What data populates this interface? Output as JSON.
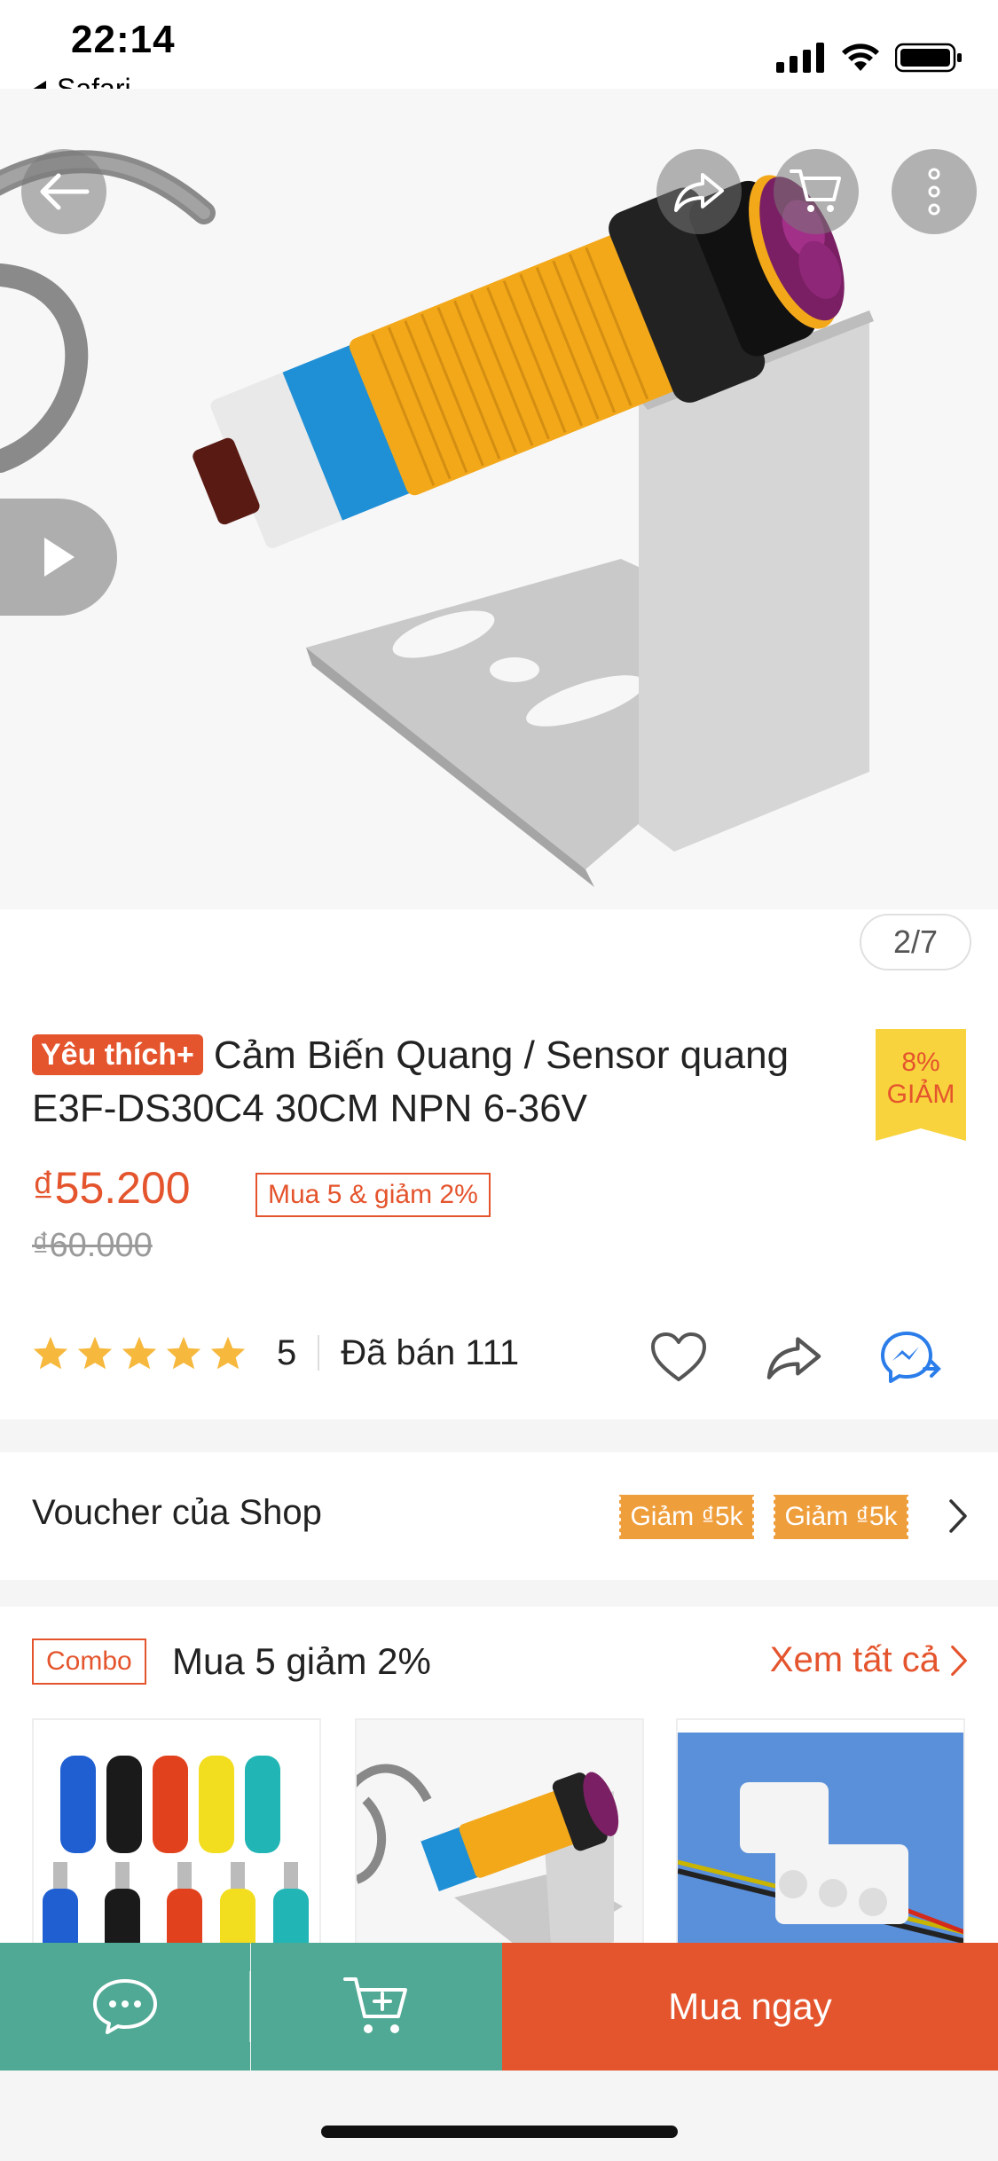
{
  "status_bar": {
    "time": "22:14",
    "back_app": "Safari"
  },
  "gallery": {
    "page_indicator": "2/7"
  },
  "product": {
    "badge": "Yêu thích+",
    "title": "Cảm Biến Quang / Sensor quang E3F-DS30C4 30CM NPN 6-36V",
    "discount_percent": "8%",
    "discount_label": "GIẢM",
    "price": "₫55.200",
    "promo": "Mua 5 & giảm 2%",
    "old_price": "₫60.000",
    "rating_value": 5,
    "rating_count": "5",
    "sold": "Đã bán 111"
  },
  "voucher": {
    "label": "Voucher của Shop",
    "chips": [
      "Giảm ₫5k",
      "Giảm ₫5k"
    ]
  },
  "combo": {
    "tag": "Combo",
    "title": "Mua 5 giảm 2%",
    "see_all": "Xem tất cả"
  },
  "bottom_bar": {
    "buy_label": "Mua ngay"
  },
  "colors": {
    "accent": "#e4542d",
    "bottom_green": "#4fa994",
    "star": "#f6b83d",
    "discount_yellow": "#f8d33d",
    "voucher_orange": "#ef9e3c",
    "messenger_blue": "#2b7de9"
  },
  "icons": {
    "back": "arrow-left-icon",
    "share": "share-icon",
    "cart": "cart-icon",
    "more": "more-vertical-icon",
    "play": "play-icon",
    "heart": "heart-icon",
    "messenger": "messenger-icon",
    "chat": "chat-icon",
    "add_to_cart": "cart-plus-icon"
  }
}
